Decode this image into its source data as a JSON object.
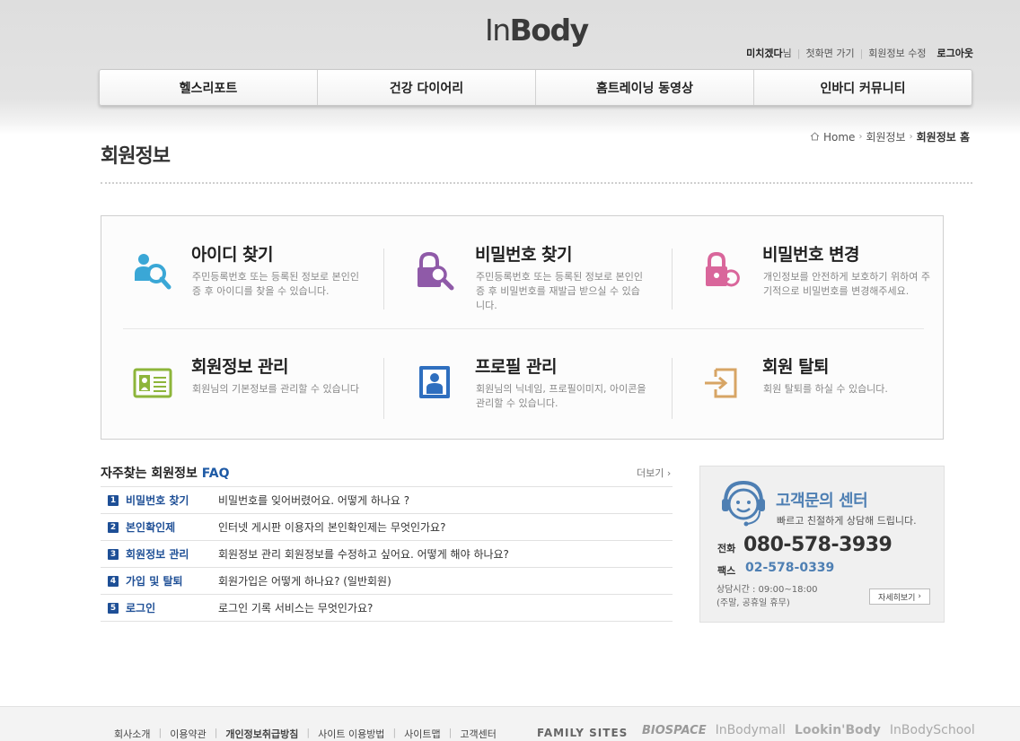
{
  "header": {
    "logo_prefix": "In",
    "logo_main": "Body",
    "util": {
      "nickname": "미치겠다",
      "suffix": "님",
      "first_page": "첫화면 가기",
      "edit_info": "회원정보 수정",
      "logout": "로그아웃"
    }
  },
  "gnb": [
    "헬스리포트",
    "건강 다이어리",
    "홈트레이닝 동영상",
    "인바디 커뮤니티"
  ],
  "breadcrumb": {
    "home": "Home",
    "level1": "회원정보",
    "current": "회원정보 홈"
  },
  "page_title": "회원정보",
  "menu_cards": [
    {
      "title": "아이디 찾기",
      "desc": "주민등록번호 또는 등록된 정보로 본인인증 후 아이디를 찾을 수 있습니다.",
      "icon": "user-search-icon",
      "color": "#3aa7d6"
    },
    {
      "title": "비밀번호 찾기",
      "desc": "주민등록번호 또는 등록된 정보로 본인인증 후 비밀번호를 재발급 받으실 수 있습니다.",
      "icon": "lock-search-icon",
      "color": "#8f5aa8"
    },
    {
      "title": "비밀번호 변경",
      "desc": "개인정보를 안전하게 보호하기 위하여 주기적으로 비밀번호를 변경해주세요.",
      "icon": "lock-refresh-icon",
      "color": "#d9669b"
    },
    {
      "title": "회원정보 관리",
      "desc": "회원님의 기본정보를 관리할 수 있습니다",
      "icon": "id-card-icon",
      "color": "#8db53a"
    },
    {
      "title": "프로필 관리",
      "desc": "회원님의 닉네임, 프로필이미지, 아이콘을 관리할 수 있습니다.",
      "icon": "profile-icon",
      "color": "#2f6fbf"
    },
    {
      "title": "회원 탈퇴",
      "desc": "회원 탈퇴를 하실 수 있습니다.",
      "icon": "exit-icon",
      "color": "#d7a565"
    }
  ],
  "faq": {
    "title_prefix": "자주찾는 회원정보",
    "title_suffix": "FAQ",
    "more": "더보기",
    "items": [
      {
        "num": "1",
        "category": "비밀번호 찾기",
        "question": "비밀번호를 잊어버렸어요. 어떻게 하나요 ?"
      },
      {
        "num": "2",
        "category": "본인확인제",
        "question": "인터넷 게시판 이용자의 본인확인제는 무엇인가요?"
      },
      {
        "num": "3",
        "category": "회원정보 관리",
        "question": "회원정보 관리 회원정보를 수정하고 싶어요. 어떻게 해야 하나요?"
      },
      {
        "num": "4",
        "category": "가입 및 탈퇴",
        "question": "회원가입은 어떻게 하나요? (일반회원)"
      },
      {
        "num": "5",
        "category": "로그인",
        "question": "로그인 기록 서비스는 무엇인가요?"
      }
    ]
  },
  "cs": {
    "title": "고객문의 센터",
    "subtitle": "빠르고 친절하게 상담해 드립니다.",
    "tel_label": "전화",
    "tel": "080-578-3939",
    "fax_label": "팩스",
    "fax": "02-578-0339",
    "hours": "상담시간 : 09:00~18:00",
    "holiday": "(주말, 공휴일 휴무)",
    "detail_button": "자세히보기"
  },
  "footer": {
    "links": [
      "회사소개",
      "이용약관",
      "개인정보취급방침",
      "사이트 이용방법",
      "사이트맵",
      "고객센터"
    ],
    "family_label": "FAMILY SITES",
    "family_sites": [
      "BIOSPACE",
      "InBodymall",
      "Lookin'Body",
      "InBodySchool"
    ]
  }
}
